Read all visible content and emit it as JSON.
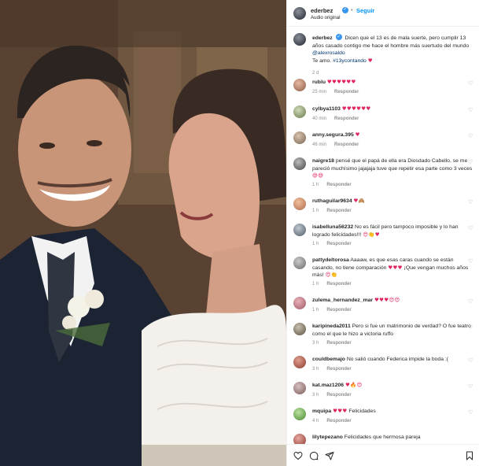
{
  "post": {
    "username": "ederbez",
    "follow_label": "Seguir",
    "dot": "•",
    "subtitle": "Audio original"
  },
  "caption": {
    "username": "ederbez",
    "text": "Dicen que el 13 es de mala suerte, pero cumplir 13 años casado contigo me hace el hombre más suertudo del mundo",
    "mention": "@alexrosaldo",
    "line2": "Te amo.",
    "hashtag": "#13ycontando",
    "time": "2 d"
  },
  "reply_label": "Responder",
  "comments": [
    {
      "user": "rublu",
      "text": "",
      "emoji": "♥♥♥♥♥♥",
      "time": "25 min",
      "reply": "Responder"
    },
    {
      "user": "cylbya1103",
      "text": "",
      "emoji": "♥♥♥♥♥♥",
      "time": "40 min",
      "reply": "Responder"
    },
    {
      "user": "anny.segura.395",
      "text": "",
      "emoji": "♥",
      "time": "46 min",
      "reply": "Responder"
    },
    {
      "user": "naigre18",
      "text": "pensé que el papá de ella era Diosdado Cabello, se me pareció muchísimo jajajaja tuve que repetir esa parte como 3 veces",
      "emoji": "😅😅",
      "time": "1 h",
      "reply": "Responder"
    },
    {
      "user": "ruthaguilar9634",
      "text": "",
      "emoji": "♥🙈",
      "time": "1 h",
      "reply": "Responder"
    },
    {
      "user": "isabelluna56232",
      "text": "No es fácil pero tampoco imposible y lo han logrado felicidades!!!",
      "emoji": "😍👏♥",
      "time": "1 h",
      "reply": "Responder"
    },
    {
      "user": "pattydeltorosa",
      "text": "Aaaaw, es que esas caras cuando se están casando, no tiene comparación",
      "emoji": "♥♥♥",
      "text2": "¡Que vengan muchos años más!",
      "emoji2": "😍👏",
      "time": "1 h",
      "reply": "Responder"
    },
    {
      "user": "zulema_hernandez_mar",
      "text": "",
      "emoji": "♥♥♥😍😍",
      "time": "1 h",
      "reply": "Responder"
    },
    {
      "user": "karipineda2011",
      "text": "Pero si fue un matrimonio de verdad? O fue teatro como el que le hizo a victoria ruffo",
      "emoji": "",
      "time": "3 h",
      "reply": "Responder"
    },
    {
      "user": "couldbemajo",
      "text": "No salió cuando Federica impide la boda :(",
      "emoji": "",
      "time": "3 h",
      "reply": "Responder"
    },
    {
      "user": "kat.maz1206",
      "text": "",
      "emoji": "♥🔥😍",
      "time": "3 h",
      "reply": "Responder"
    },
    {
      "user": "mquipa",
      "text": "Felicidades",
      "emoji": "♥♥♥",
      "time": "4 h",
      "reply": "Responder"
    },
    {
      "user": "lilytepezano",
      "text": "Felicidades que hermosa pareja",
      "emoji": "",
      "time": "",
      "reply": ""
    }
  ],
  "icons": {
    "like": "heart-icon",
    "comment": "comment-icon",
    "share": "share-icon",
    "save": "bookmark-icon"
  },
  "colors": {
    "link": "#00376b",
    "follow": "#0095f6",
    "heart": "#e0245e",
    "verified": "#3897f0"
  }
}
